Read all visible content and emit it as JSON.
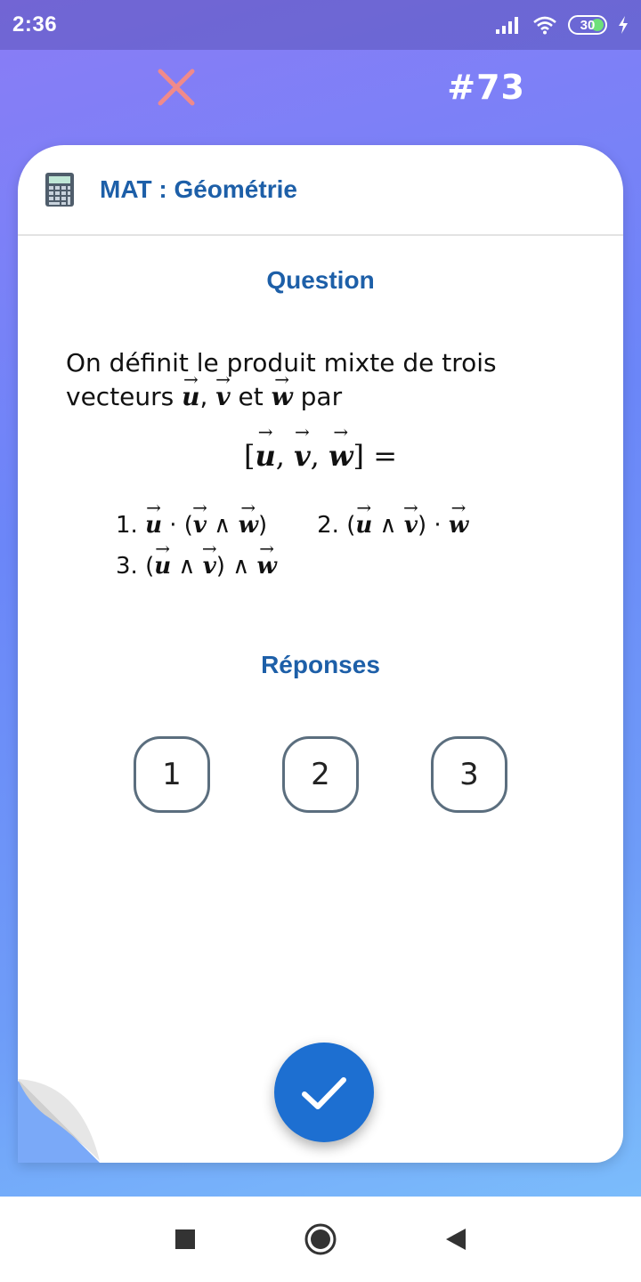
{
  "status_bar": {
    "time": "2:36",
    "battery": "30",
    "icons": [
      "signal-icon",
      "wifi-icon",
      "battery-icon",
      "charging-icon"
    ]
  },
  "header": {
    "close_icon": "close-icon",
    "card_number": "#73"
  },
  "card": {
    "subject_icon": "calculator-icon",
    "subject": "MAT : Géométrie",
    "question_title": "Question",
    "question_text_line1": "On définit le produit mixte de trois",
    "question_text_line2_prefix": "vecteurs",
    "question_text_line2_suffix": "par",
    "answers_title": "Réponses",
    "answers": [
      "1",
      "2",
      "3"
    ]
  },
  "fab": {
    "icon": "checkmark-icon"
  },
  "nav_bar": {
    "icons": [
      "recent-apps-icon",
      "home-icon",
      "back-icon"
    ]
  },
  "colors": {
    "accent": "#1d5fa8",
    "fab": "#1d6fd1",
    "close": "#f08a8a",
    "answer_border": "#5b6e7e"
  }
}
